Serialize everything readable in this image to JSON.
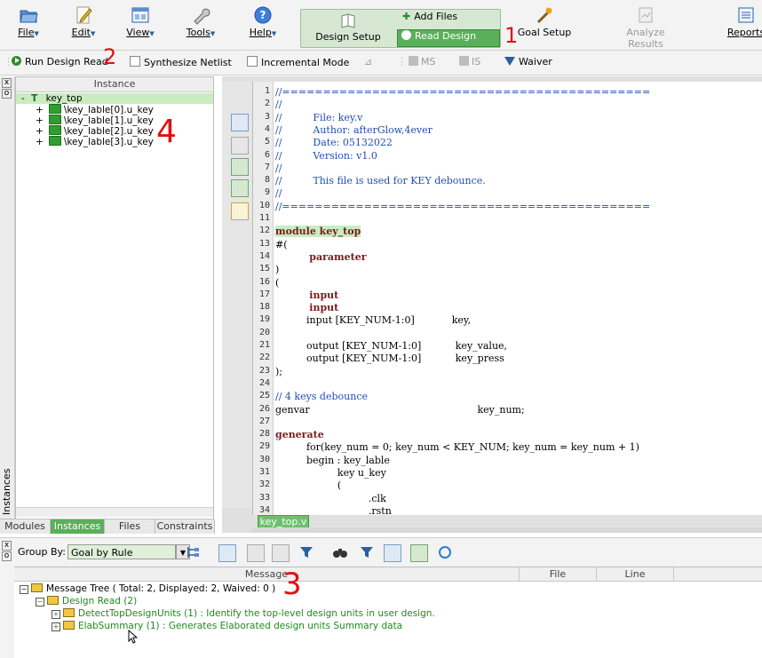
{
  "menubar": {
    "items": [
      {
        "label": "File"
      },
      {
        "label": "Edit"
      },
      {
        "label": "View"
      },
      {
        "label": "Tools"
      },
      {
        "label": "Help"
      }
    ],
    "design_setup": "Design Setup",
    "add_files": "Add Files",
    "read_design": "Read Design",
    "goal_setup": "Goal Setup",
    "analyze_results": "Analyze Results",
    "reports": "Reports"
  },
  "toolbar2": {
    "run_design_read": "Run Design Read",
    "synthesize_netlist": "Synthesize Netlist",
    "incremental_mode": "Incremental Mode",
    "ms": "MS",
    "is": "IS",
    "waiver": "Waiver"
  },
  "instance_panel": {
    "header": "Instance",
    "root": "key_top",
    "root_prefix": "T",
    "children": [
      "\\key_lable[0].u_key",
      "\\key_lable[1].u_key",
      "\\key_lable[2].u_key",
      "\\key_lable[3].u_key"
    ],
    "side_label": "Instances",
    "tabs": [
      "Modules",
      "Instances",
      "Files",
      "Constraints"
    ]
  },
  "editor": {
    "file_tab": "key_top.v",
    "lines": [
      {
        "n": "1",
        "text": "//=============================================",
        "cls": "cmt"
      },
      {
        "n": "2",
        "text": "//",
        "cls": "cmt"
      },
      {
        "n": "3",
        "text": "//          File: key.v",
        "cls": "cmt"
      },
      {
        "n": "4",
        "text": "//          Author: afterGlow,4ever",
        "cls": "cmt"
      },
      {
        "n": "5",
        "text": "//          Date: 05132022",
        "cls": "cmt"
      },
      {
        "n": "6",
        "text": "//          Version: v1.0",
        "cls": "cmt"
      },
      {
        "n": "7",
        "text": "//",
        "cls": "cmt"
      },
      {
        "n": "8",
        "text": "//          This file is used for KEY debounce.",
        "cls": "cmt"
      },
      {
        "n": "9",
        "text": "//",
        "cls": "cmt"
      },
      {
        "n": "10",
        "text": "//=============================================",
        "cls": "cmt"
      },
      {
        "n": "11",
        "text": "",
        "cls": ""
      },
      {
        "n": "12",
        "text": "module key_top",
        "cls": "kw hl"
      },
      {
        "n": "13",
        "text": "#(",
        "cls": ""
      },
      {
        "n": "14",
        "text": "          parameter",
        "cls": "kw"
      },
      {
        "n": "15",
        "text": ")",
        "cls": ""
      },
      {
        "n": "16",
        "text": "(",
        "cls": ""
      },
      {
        "n": "17",
        "text": "          input",
        "cls": "kw"
      },
      {
        "n": "18",
        "text": "          input",
        "cls": "kw"
      },
      {
        "n": "19",
        "text": "          input [KEY_NUM-1:0]            key,",
        "cls": ""
      },
      {
        "n": "20",
        "text": "",
        "cls": ""
      },
      {
        "n": "21",
        "text": "          output [KEY_NUM-1:0]           key_value,",
        "cls": ""
      },
      {
        "n": "22",
        "text": "          output [KEY_NUM-1:0]           key_press",
        "cls": ""
      },
      {
        "n": "23",
        "text": ");",
        "cls": ""
      },
      {
        "n": "24",
        "text": "",
        "cls": ""
      },
      {
        "n": "25",
        "text": "// 4 keys debounce",
        "cls": "cmt"
      },
      {
        "n": "26",
        "text": "genvar                                                      key_num;",
        "cls": ""
      },
      {
        "n": "27",
        "text": "",
        "cls": ""
      },
      {
        "n": "28",
        "text": "generate",
        "cls": "kw"
      },
      {
        "n": "29",
        "text": "          for(key_num = 0; key_num < KEY_NUM; key_num = key_num + 1)",
        "cls": ""
      },
      {
        "n": "30",
        "text": "          begin : key_lable",
        "cls": ""
      },
      {
        "n": "31",
        "text": "                    key u_key",
        "cls": ""
      },
      {
        "n": "32",
        "text": "                    (",
        "cls": ""
      },
      {
        "n": "33",
        "text": "                              .clk",
        "cls": ""
      },
      {
        "n": "34",
        "text": "                              .rstn",
        "cls": ""
      }
    ]
  },
  "bottom": {
    "group_by_label": "Group By:",
    "group_by_value": "Goal by Rule",
    "columns": [
      "Message",
      "File",
      "Line"
    ],
    "tree_root": "Message Tree ( Total: 2, Displayed: 2, Waived: 0 )",
    "design_read": "Design Read (2)",
    "msg1": "DetectTopDesignUnits (1) : Identify the top-level design units in user design.",
    "msg2": "ElabSummary (1) : Generates Elaborated design units Summary data"
  },
  "annotations": [
    "1",
    "2",
    "3",
    "4"
  ],
  "colors": {
    "accent_green": "#5ab05a",
    "comment_blue": "#1f4fb0",
    "keyword": "#7b1a1a",
    "annotation_red": "#e01010"
  }
}
